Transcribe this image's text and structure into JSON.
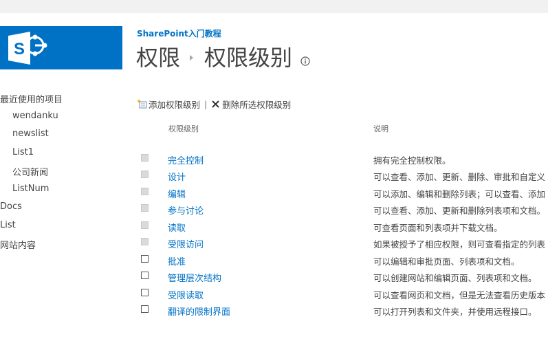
{
  "site": {
    "name": "SharePoint入门教程"
  },
  "breadcrumb": {
    "parent": "权限",
    "current": "权限级别"
  },
  "icons": {
    "info": "info-icon",
    "add": "add-level-icon",
    "delete": "delete-icon",
    "logo": "sharepoint-logo"
  },
  "colors": {
    "brand": "#0072c6",
    "link": "#0072c6"
  },
  "leftnav": {
    "recent_header": "最近使用的项目",
    "recent_items": [
      "wendanku",
      "newslist",
      "List1",
      "公司新闻",
      "ListNum"
    ],
    "items": [
      "Docs",
      "List",
      "网站内容"
    ]
  },
  "toolbar": {
    "add_label": "添加权限级别",
    "separator": "|",
    "delete_label": "删除所选权限级别"
  },
  "table": {
    "col_level": "权限级别",
    "col_desc": "说明",
    "rows": [
      {
        "name": "完全控制",
        "desc": "拥有完全控制权限。",
        "checkbox_enabled": false
      },
      {
        "name": "设计",
        "desc": "可以查看、添加、更新、删除、审批和自定义",
        "checkbox_enabled": false
      },
      {
        "name": "编辑",
        "desc": "可以添加、编辑和删除列表；可以查看、添加",
        "checkbox_enabled": false
      },
      {
        "name": "参与讨论",
        "desc": "可以查看、添加、更新和删除列表项和文档。",
        "checkbox_enabled": false
      },
      {
        "name": "读取",
        "desc": "可查看页面和列表项并下载文档。",
        "checkbox_enabled": false
      },
      {
        "name": "受限访问",
        "desc": "如果被授予了相应权限，则可查看指定的列表",
        "checkbox_enabled": false
      },
      {
        "name": "批准",
        "desc": "可以编辑和审批页面、列表项和文档。",
        "checkbox_enabled": true
      },
      {
        "name": "管理层次结构",
        "desc": "可以创建网站和编辑页面、列表项和文档。",
        "checkbox_enabled": true
      },
      {
        "name": "受限读取",
        "desc": "可以查看网页和文档，但是无法查看历史版本",
        "checkbox_enabled": true
      },
      {
        "name": "翻译的限制界面",
        "desc": "可以打开列表和文件夹，并使用远程接口。",
        "checkbox_enabled": true
      }
    ]
  }
}
